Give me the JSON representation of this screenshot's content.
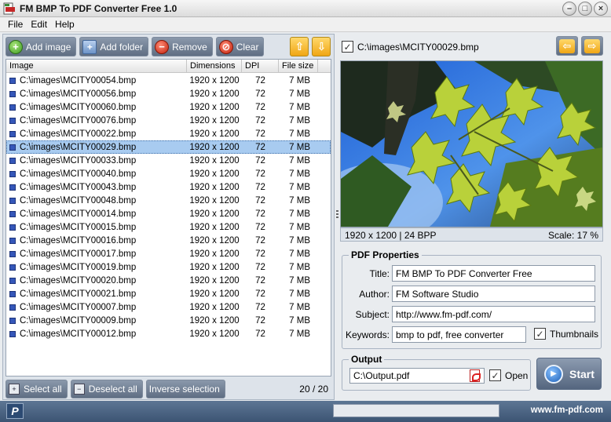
{
  "window": {
    "title": "FM BMP To PDF Converter Free 1.0",
    "minimize": "–",
    "maximize": "□",
    "close": "×"
  },
  "menu": [
    "File",
    "Edit",
    "Help"
  ],
  "toolbar": {
    "add_image": "Add image",
    "add_folder": "Add folder",
    "remove": "Remove",
    "clear": "Clear",
    "up": "⇧",
    "down": "⇩"
  },
  "columns": {
    "image": "Image",
    "dimensions": "Dimensions",
    "dpi": "DPI",
    "size": "File size"
  },
  "files": [
    {
      "path": "C:\\images\\MCITY00054.bmp",
      "dims": "1920 x 1200",
      "dpi": "72",
      "size": "7 MB"
    },
    {
      "path": "C:\\images\\MCITY00056.bmp",
      "dims": "1920 x 1200",
      "dpi": "72",
      "size": "7 MB"
    },
    {
      "path": "C:\\images\\MCITY00060.bmp",
      "dims": "1920 x 1200",
      "dpi": "72",
      "size": "7 MB"
    },
    {
      "path": "C:\\images\\MCITY00076.bmp",
      "dims": "1920 x 1200",
      "dpi": "72",
      "size": "7 MB"
    },
    {
      "path": "C:\\images\\MCITY00022.bmp",
      "dims": "1920 x 1200",
      "dpi": "72",
      "size": "7 MB"
    },
    {
      "path": "C:\\images\\MCITY00029.bmp",
      "dims": "1920 x 1200",
      "dpi": "72",
      "size": "7 MB"
    },
    {
      "path": "C:\\images\\MCITY00033.bmp",
      "dims": "1920 x 1200",
      "dpi": "72",
      "size": "7 MB"
    },
    {
      "path": "C:\\images\\MCITY00040.bmp",
      "dims": "1920 x 1200",
      "dpi": "72",
      "size": "7 MB"
    },
    {
      "path": "C:\\images\\MCITY00043.bmp",
      "dims": "1920 x 1200",
      "dpi": "72",
      "size": "7 MB"
    },
    {
      "path": "C:\\images\\MCITY00048.bmp",
      "dims": "1920 x 1200",
      "dpi": "72",
      "size": "7 MB"
    },
    {
      "path": "C:\\images\\MCITY00014.bmp",
      "dims": "1920 x 1200",
      "dpi": "72",
      "size": "7 MB"
    },
    {
      "path": "C:\\images\\MCITY00015.bmp",
      "dims": "1920 x 1200",
      "dpi": "72",
      "size": "7 MB"
    },
    {
      "path": "C:\\images\\MCITY00016.bmp",
      "dims": "1920 x 1200",
      "dpi": "72",
      "size": "7 MB"
    },
    {
      "path": "C:\\images\\MCITY00017.bmp",
      "dims": "1920 x 1200",
      "dpi": "72",
      "size": "7 MB"
    },
    {
      "path": "C:\\images\\MCITY00019.bmp",
      "dims": "1920 x 1200",
      "dpi": "72",
      "size": "7 MB"
    },
    {
      "path": "C:\\images\\MCITY00020.bmp",
      "dims": "1920 x 1200",
      "dpi": "72",
      "size": "7 MB"
    },
    {
      "path": "C:\\images\\MCITY00021.bmp",
      "dims": "1920 x 1200",
      "dpi": "72",
      "size": "7 MB"
    },
    {
      "path": "C:\\images\\MCITY00007.bmp",
      "dims": "1920 x 1200",
      "dpi": "72",
      "size": "7 MB"
    },
    {
      "path": "C:\\images\\MCITY00009.bmp",
      "dims": "1920 x 1200",
      "dpi": "72",
      "size": "7 MB"
    },
    {
      "path": "C:\\images\\MCITY00012.bmp",
      "dims": "1920 x 1200",
      "dpi": "72",
      "size": "7 MB"
    }
  ],
  "selected_index": 5,
  "bottom": {
    "select_all": "Select all",
    "deselect_all": "Deselect all",
    "inverse": "Inverse selection",
    "count": "20 / 20"
  },
  "preview": {
    "path": "C:\\images\\MCITY00029.bmp",
    "info": "1920 x 1200 | 24 BPP",
    "scale": "Scale: 17 %",
    "checked": "✓",
    "prev": "⇦",
    "next": "⇨"
  },
  "pdf": {
    "group": "PDF Properties",
    "title_label": "Title:",
    "title": "FM BMP To PDF Converter Free",
    "author_label": "Author:",
    "author": "FM Software Studio",
    "subject_label": "Subject:",
    "subject": "http://www.fm-pdf.com/",
    "keywords_label": "Keywords:",
    "keywords": "bmp to pdf, free converter",
    "thumbnails_label": "Thumbnails",
    "thumbnails_checked": "✓"
  },
  "output": {
    "group": "Output",
    "file": "C:\\Output.pdf",
    "open_label": "Open",
    "open_checked": "✓"
  },
  "start": {
    "label": "Start",
    "icon": "▶"
  },
  "status": {
    "logo": "P",
    "site": "www.fm-pdf.com"
  },
  "icons": {
    "add": "+",
    "remove": "−",
    "clear": "⊘",
    "folder": "+",
    "select": "+",
    "deselect": "−"
  },
  "colors": {
    "selection": "#a8cbf0",
    "button": "#5f6e83",
    "accent": "#f0a614"
  }
}
